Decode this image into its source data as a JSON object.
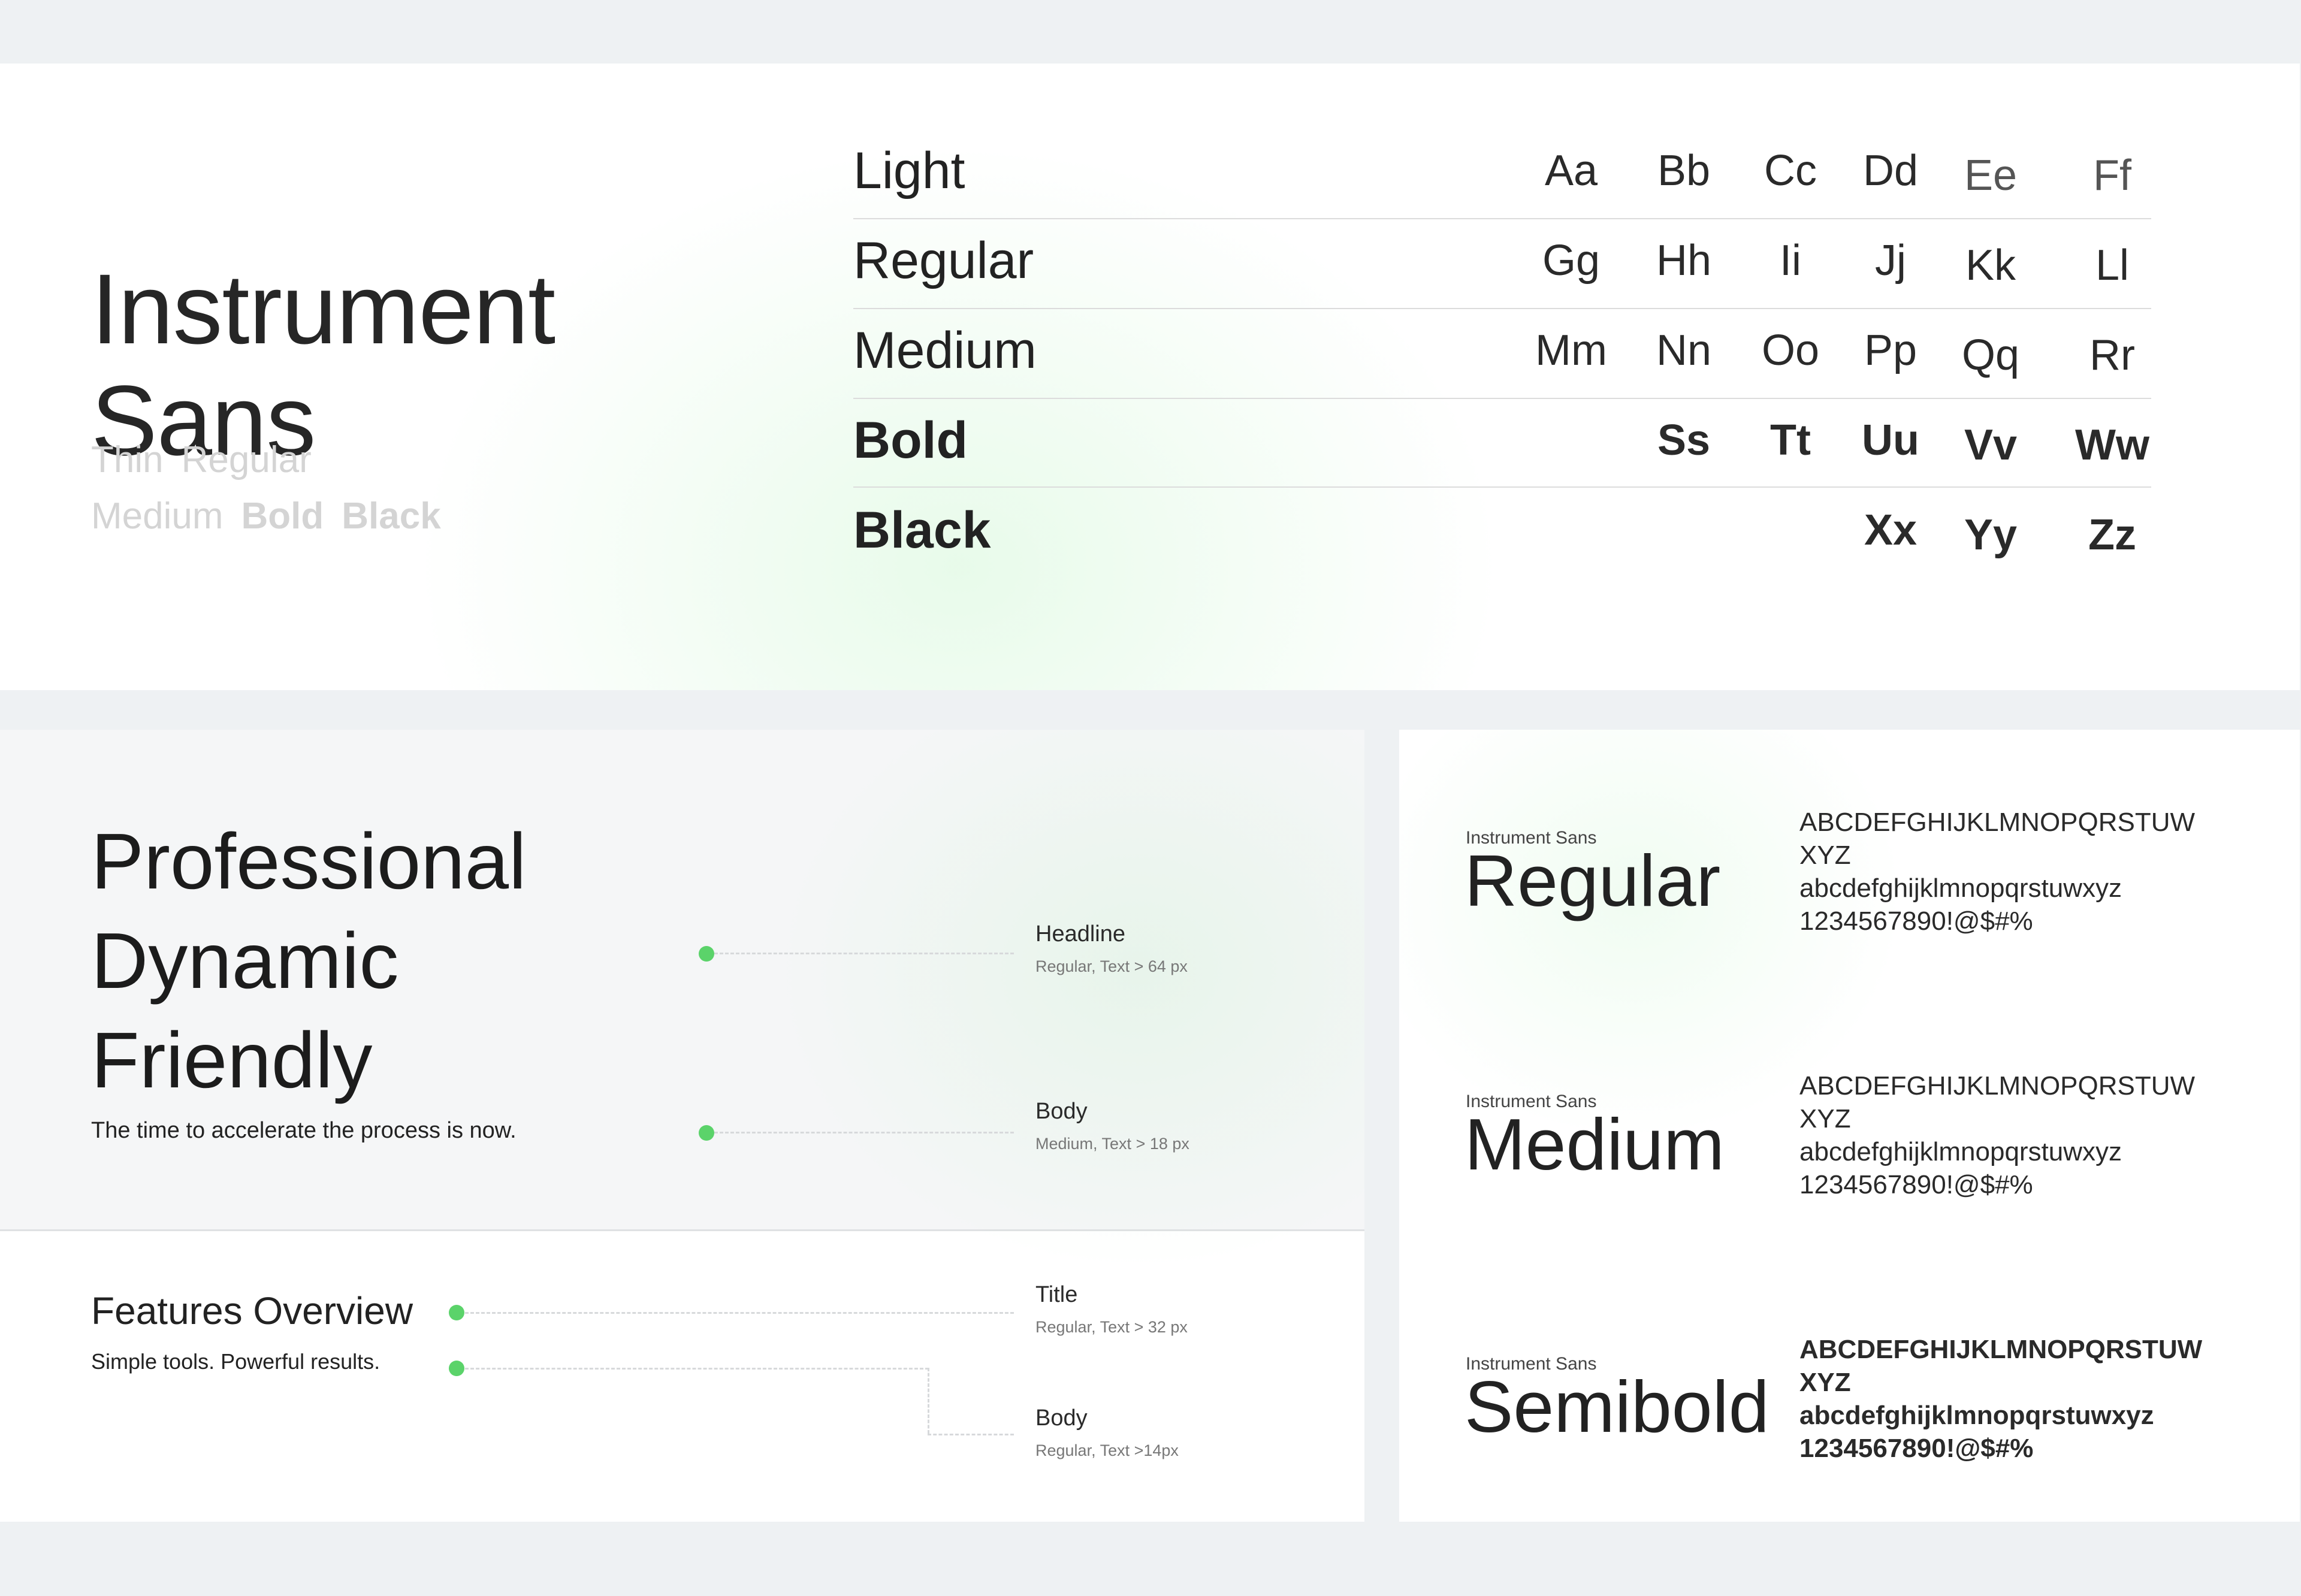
{
  "top_panel": {
    "font_name_line1": "Instrument",
    "font_name_line2": "Sans",
    "weights_row1": [
      "Thin",
      "Regular"
    ],
    "weights_row2": [
      "Medium",
      "Bold",
      "Black"
    ],
    "rows": [
      {
        "label": "Light",
        "glyphs": [
          "Aa",
          "Bb",
          "Cc",
          "Dd",
          "Ee",
          "Ff"
        ]
      },
      {
        "label": "Regular",
        "glyphs": [
          "Gg",
          "Hh",
          "Ii",
          "Jj",
          "Kk",
          "Ll"
        ]
      },
      {
        "label": "Medium",
        "glyphs": [
          "Mm",
          "Nn",
          "Oo",
          "Pp",
          "Qq",
          "Rr"
        ]
      },
      {
        "label": "Bold",
        "glyphs": [
          "",
          "Ss",
          "Tt",
          "Uu",
          "Vv",
          "Ww"
        ]
      },
      {
        "label": "Black",
        "glyphs": [
          "",
          "",
          "",
          "Xx",
          "Yy",
          "Zz"
        ]
      }
    ]
  },
  "hierarchy_panel": {
    "headline_words": [
      "Professional",
      "Dynamic",
      "Friendly"
    ],
    "body_text": "The time to accelerate the process is now.",
    "specs": [
      {
        "name": "Headline",
        "meta": "Regular, Text > 64 px"
      },
      {
        "name": "Body",
        "meta": "Medium, Text > 18 px"
      }
    ]
  },
  "features_panel": {
    "title": "Features Overview",
    "body": "Simple tools. Powerful results.",
    "specs": [
      {
        "name": "Title",
        "meta": "Regular, Text > 32 px"
      },
      {
        "name": "Body",
        "meta": "Regular, Text >14px"
      }
    ]
  },
  "weights_panel": {
    "family_caption": "Instrument Sans",
    "items": [
      {
        "name": "Regular",
        "charset": "ABCDEFGHIJKLMNOPQRSTUW\nXYZ\nabcdefghijklmnopqrstuwxyz\n1234567890!@$#%"
      },
      {
        "name": "Medium",
        "charset": "ABCDEFGHIJKLMNOPQRSTUW\nXYZ\nabcdefghijklmnopqrstuwxyz\n1234567890!@$#%"
      },
      {
        "name": "Semibold",
        "charset": "ABCDEFGHIJKLMNOPQRSTUW\nXYZ\nabcdefghijklmnopqrstuwxyz\n1234567890!@$#%"
      }
    ]
  },
  "colors": {
    "accent_dot": "#5bd36a",
    "background": "#eef1f3"
  }
}
